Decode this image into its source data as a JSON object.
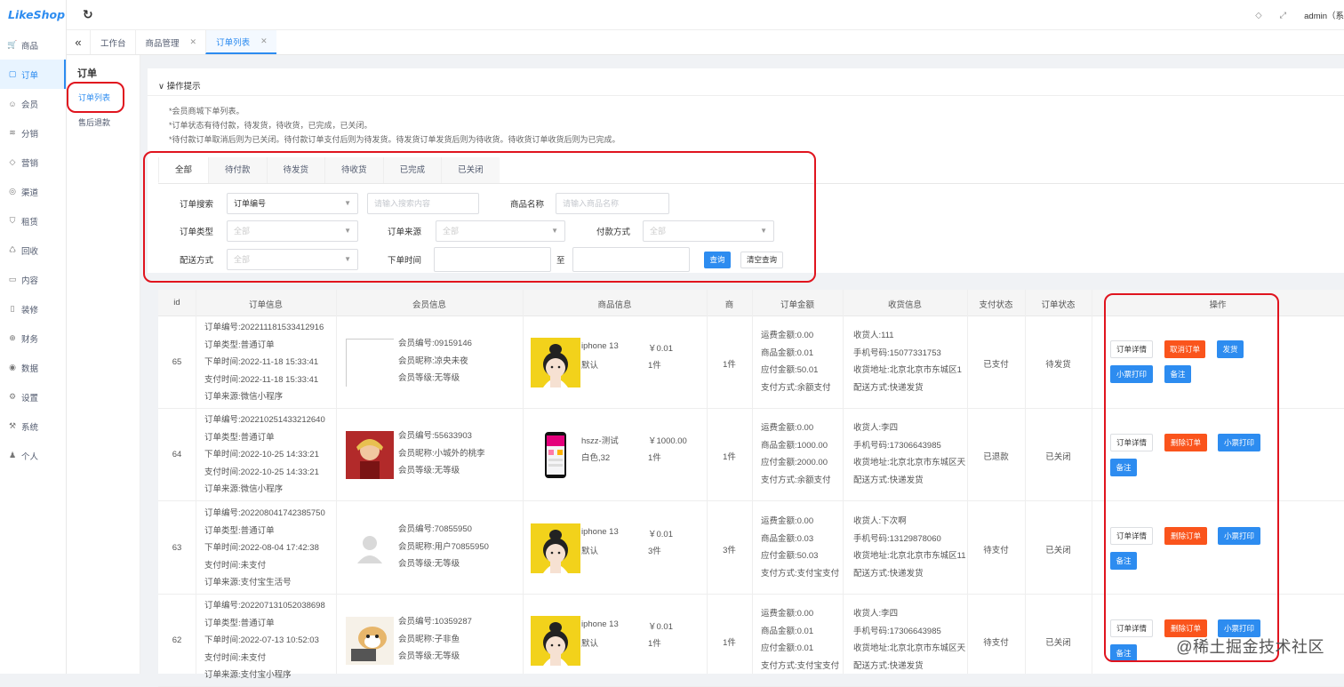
{
  "app": {
    "logo": "LikeShop"
  },
  "topbar": {
    "user": "admin（系"
  },
  "sidebar": {
    "items": [
      {
        "label": "商品",
        "icon": "cart-icon"
      },
      {
        "label": "订单",
        "icon": "order-icon"
      },
      {
        "label": "会员",
        "icon": "user-icon"
      },
      {
        "label": "分销",
        "icon": "layers-icon"
      },
      {
        "label": "营销",
        "icon": "diamond-icon"
      },
      {
        "label": "渠道",
        "icon": "channel-icon"
      },
      {
        "label": "租赁",
        "icon": "shield-icon"
      },
      {
        "label": "回收",
        "icon": "recycle-icon"
      },
      {
        "label": "内容",
        "icon": "content-icon"
      },
      {
        "label": "装修",
        "icon": "decorate-icon"
      },
      {
        "label": "财务",
        "icon": "finance-icon"
      },
      {
        "label": "数据",
        "icon": "data-icon"
      },
      {
        "label": "设置",
        "icon": "gear-icon"
      },
      {
        "label": "系统",
        "icon": "system-icon"
      },
      {
        "label": "个人",
        "icon": "person-icon"
      }
    ]
  },
  "tabs": [
    {
      "label": "工作台"
    },
    {
      "label": "商品管理"
    },
    {
      "label": "订单列表"
    }
  ],
  "subnav": {
    "title": "订单",
    "items": [
      "订单列表",
      "售后退款"
    ]
  },
  "hint": {
    "title": "操作提示",
    "lines": [
      "*会员商城下单列表。",
      "*订单状态有待付款，待发货，待收货，已完成，已关闭。",
      "*待付款订单取消后则为已关闭。待付款订单支付后则为待发货。待发货订单发货后则为待收货。待收货订单收货后则为已完成。"
    ]
  },
  "filter": {
    "tabs": [
      "全部",
      "待付款",
      "待发货",
      "待收货",
      "已完成",
      "已关闭"
    ],
    "order_search_label": "订单搜索",
    "order_search_type": "订单编号",
    "order_search_placeholder": "请输入搜索内容",
    "product_name_label": "商品名称",
    "product_name_placeholder": "请输入商品名称",
    "order_type_label": "订单类型",
    "order_type_value": "全部",
    "order_source_label": "订单来源",
    "order_source_value": "全部",
    "pay_method_label": "付款方式",
    "pay_method_value": "全部",
    "delivery_label": "配送方式",
    "delivery_value": "全部",
    "order_time_label": "下单时间",
    "to_label": "至",
    "query_button": "查询",
    "reset_button": "清空查询"
  },
  "table": {
    "headers": [
      "id",
      "订单信息",
      "会员信息",
      "商品信息",
      "商",
      "订单金额",
      "收货信息",
      "支付状态",
      "订单状态",
      "操作"
    ],
    "rows": [
      {
        "id": "65",
        "order": [
          "订单编号:202211181533412916",
          "订单类型:普通订单",
          "下单时间:2022-11-18 15:33:41",
          "支付时间:2022-11-18 15:33:41",
          "订单来源:微信小程序"
        ],
        "member": [
          "会员编号:09159146",
          "会员昵称:凉央未夜",
          "会员等级:无等级"
        ],
        "product_name": "iphone 13",
        "product_spec": "默认",
        "price": "￥0.01",
        "qty": "1件",
        "count": "1件",
        "amount": [
          "运费金额:0.00",
          "商品金额:0.01",
          "应付金额:50.01",
          "支付方式:余额支付"
        ],
        "address": [
          "收货人:111",
          "手机号码:15077331753",
          "收货地址:北京北京市东城区1",
          "配送方式:快递发货"
        ],
        "pay_status": "已支付",
        "order_status": "待发货",
        "actions": [
          "订单详情",
          "取消订单",
          "发货",
          "小票打印",
          "备注"
        ]
      },
      {
        "id": "64",
        "order": [
          "订单编号:202210251433212640",
          "订单类型:普通订单",
          "下单时间:2022-10-25 14:33:21",
          "支付时间:2022-10-25 14:33:21",
          "订单来源:微信小程序"
        ],
        "member": [
          "会员编号:55633903",
          "会员昵称:小城外的桃李",
          "会员等级:无等级"
        ],
        "product_name": "hszz-测试",
        "product_spec": "白色,32",
        "price": "￥1000.00",
        "qty": "1件",
        "count": "1件",
        "amount": [
          "运费金额:0.00",
          "商品金额:1000.00",
          "应付金额:2000.00",
          "支付方式:余额支付"
        ],
        "address": [
          "收货人:李四",
          "手机号码:17306643985",
          "收货地址:北京北京市东城区天",
          "配送方式:快递发货"
        ],
        "pay_status": "已退款",
        "order_status": "已关闭",
        "actions": [
          "订单详情",
          "删除订单",
          "小票打印",
          "备注"
        ]
      },
      {
        "id": "63",
        "order": [
          "订单编号:202208041742385750",
          "订单类型:普通订单",
          "下单时间:2022-08-04 17:42:38",
          "支付时间:未支付",
          "订单来源:支付宝生活号"
        ],
        "member": [
          "会员编号:70855950",
          "会员昵称:用户70855950",
          "会员等级:无等级"
        ],
        "product_name": "iphone 13",
        "product_spec": "默认",
        "price": "￥0.01",
        "qty": "3件",
        "count": "3件",
        "amount": [
          "运费金额:0.00",
          "商品金额:0.03",
          "应付金额:50.03",
          "支付方式:支付宝支付"
        ],
        "address": [
          "收货人:下次啊",
          "手机号码:13129878060",
          "收货地址:北京北京市东城区11",
          "配送方式:快递发货"
        ],
        "pay_status": "待支付",
        "order_status": "已关闭",
        "actions": [
          "订单详情",
          "删除订单",
          "小票打印",
          "备注"
        ]
      },
      {
        "id": "62",
        "order": [
          "订单编号:202207131052038698",
          "订单类型:普通订单",
          "下单时间:2022-07-13 10:52:03",
          "支付时间:未支付",
          "订单来源:支付宝小程序"
        ],
        "member": [
          "会员编号:10359287",
          "会员昵称:子非鱼",
          "会员等级:无等级"
        ],
        "product_name": "iphone 13",
        "product_spec": "默认",
        "price": "￥0.01",
        "qty": "1件",
        "count": "1件",
        "amount": [
          "运费金额:0.00",
          "商品金额:0.01",
          "应付金额:0.01",
          "支付方式:支付宝支付"
        ],
        "address": [
          "收货人:李四",
          "手机号码:17306643985",
          "收货地址:北京北京市东城区天",
          "配送方式:快递发货"
        ],
        "pay_status": "待支付",
        "order_status": "已关闭",
        "actions": [
          "订单详情",
          "删除订单",
          "小票打印",
          "备注"
        ]
      }
    ]
  },
  "watermark": "@稀土掘金技术社区",
  "colors": {
    "primary": "#2d8cf0",
    "danger": "#fa541c",
    "highlight": "#e0141e"
  }
}
